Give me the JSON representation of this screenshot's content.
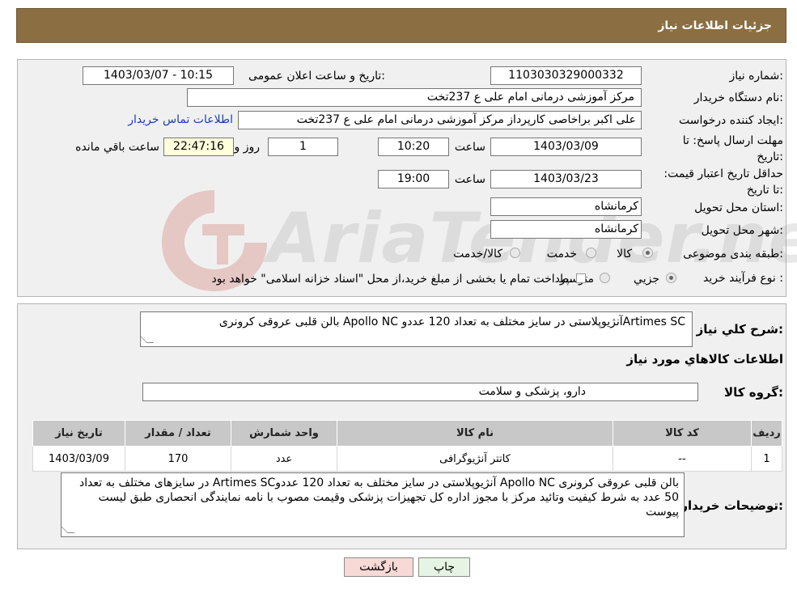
{
  "header": {
    "title": "جزئیات اطلاعات نیاز"
  },
  "watermark": "AriaTender.neT",
  "fields": {
    "need_number_label": "شماره نیاز:",
    "need_number": "1103030329000332",
    "announce_label": "تاریخ و ساعت اعلان عمومی:",
    "announce_value": "1403/03/07 - 10:15",
    "buyer_label": "نام دستگاه خریدار:",
    "buyer_value": "مرکز آموزشی درمانی امام علی ع 237تخت",
    "creator_label": "ایجاد کننده درخواست:",
    "creator_value": "علی اکبر براخاصی کارپرداز  مرکز آموزشی درمانی امام علی ع 237تخت",
    "contact_link": "اطلاعات تماس خریدار",
    "deadline_label": "مهلت ارسال پاسخ: تا تاریخ:",
    "deadline_date": "1403/03/09",
    "time_word": "ساعت",
    "deadline_time": "10:20",
    "days_value": "1",
    "days_word": "روز و",
    "remaining_time": "22:47:16",
    "remaining_word": "ساعت باقي مانده",
    "validity_label": "حداقل تاریخ اعتبار قیمت: تا تاریخ:",
    "validity_date": "1403/03/23",
    "validity_time": "19:00",
    "province_label": "استان محل تحویل:",
    "province_value": "کرمانشاه",
    "city_label": "شهر محل تحویل:",
    "city_value": "کرمانشاه",
    "category_label": "طبقه بندی موضوعی:",
    "cat_goods": "کالا",
    "cat_service": "خدمت",
    "cat_both": "کالا/خدمت",
    "purchase_label": "نوع فرآیند خرید :",
    "pur_partial": "جزیي",
    "pur_medium": "متوسط",
    "pur_note": "پرداخت تمام یا بخشی از مبلغ خرید،از محل \"اسناد خزانه اسلامی\" خواهد بود."
  },
  "summary": {
    "label": "شرح كلي نياز:",
    "value": "بالن قلبی عروقی کرونری Apollo NC آنژیوپلاستی در سایز مختلف  به تعداد 120 عددوArtimes SC"
  },
  "goods": {
    "section_title": "اطلاعات كالاهاي مورد نياز",
    "group_label": "گروه کالا:",
    "group_value": "دارو، پزشکی و سلامت"
  },
  "table": {
    "headers": [
      "ردیف",
      "کد کالا",
      "نام کالا",
      "واحد شمارش",
      "تعداد / مقدار",
      "تاریخ نیاز"
    ],
    "rows": [
      [
        "1",
        "--",
        "کاتتر آنژیوگرافی",
        "عدد",
        "170",
        "1403/03/09"
      ]
    ]
  },
  "notes": {
    "label": "توضیحات خریدار:",
    "value": "بالن قلبی عروقی کرونری Apollo NC آنژیوپلاستی در سایز مختلف  به تعداد 120 عددوArtimes SC  در سایزهای مختلف به تعداد 50 عدد به شرط کیفیت وتائید مرکز با مجوز اداره کل تجهیزات پزشکی وقیمت مصوب با نامه نمایندگی انحصاری طبق لیست پیوست"
  },
  "buttons": {
    "print": "چاپ",
    "back": "بازگشت"
  },
  "colors": {
    "header": "#8b6e42",
    "back_button": "#f7d9d6",
    "print_button": "#e6f5e3",
    "link": "#1a3fb3"
  }
}
